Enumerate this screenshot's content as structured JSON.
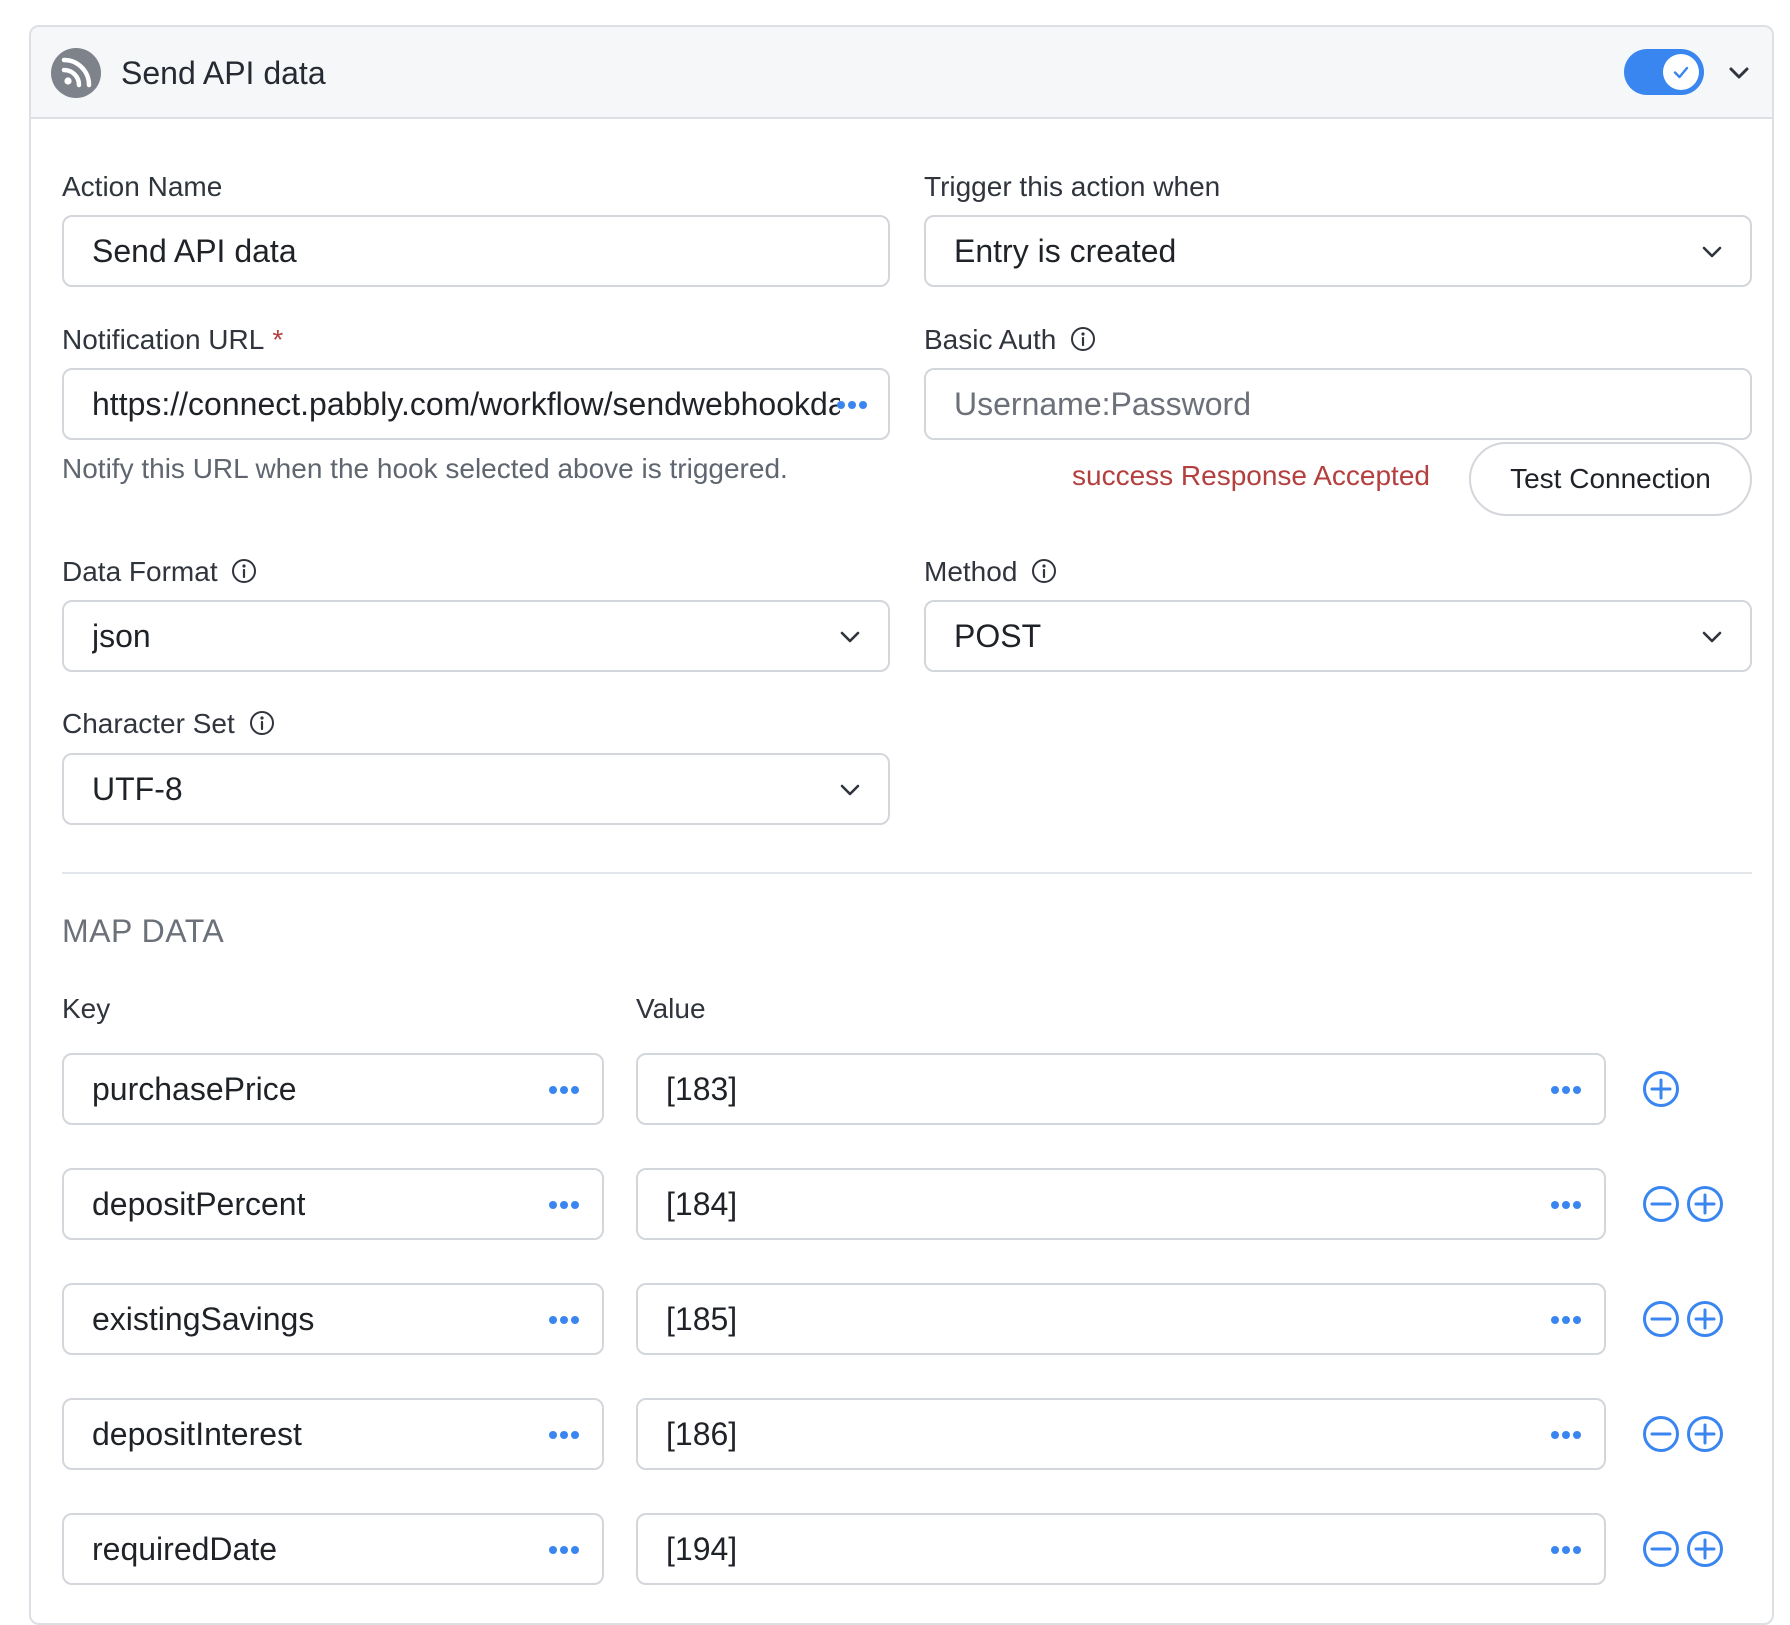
{
  "header": {
    "title": "Send API data",
    "toggle_on": true,
    "icon": "rss-icon"
  },
  "action_name": {
    "label": "Action Name",
    "value": "Send API data"
  },
  "trigger": {
    "label": "Trigger this action when",
    "value": "Entry is created"
  },
  "notification_url": {
    "label": "Notification URL",
    "required_mark": "*",
    "value": "https://connect.pabbly.com/workflow/sendwebhookdata/",
    "helper": "Notify this URL when the hook selected above is triggered."
  },
  "basic_auth": {
    "label": "Basic Auth",
    "placeholder": "Username:Password",
    "status": "success Response Accepted",
    "test_button": "Test Connection"
  },
  "data_format": {
    "label": "Data Format",
    "value": "json"
  },
  "method": {
    "label": "Method",
    "value": "POST"
  },
  "charset": {
    "label": "Character Set",
    "value": "UTF-8"
  },
  "map_data": {
    "title": "MAP DATA",
    "key_header": "Key",
    "value_header": "Value",
    "rows": [
      {
        "key": "purchasePrice",
        "value": "[183]"
      },
      {
        "key": "depositPercent",
        "value": "[184]"
      },
      {
        "key": "existingSavings",
        "value": "[185]"
      },
      {
        "key": "depositInterest",
        "value": "[186]"
      },
      {
        "key": "requiredDate",
        "value": "[194]"
      }
    ]
  },
  "colors": {
    "accent": "#3a86f0",
    "error_text": "#b3403f",
    "border": "#d3d6db"
  }
}
